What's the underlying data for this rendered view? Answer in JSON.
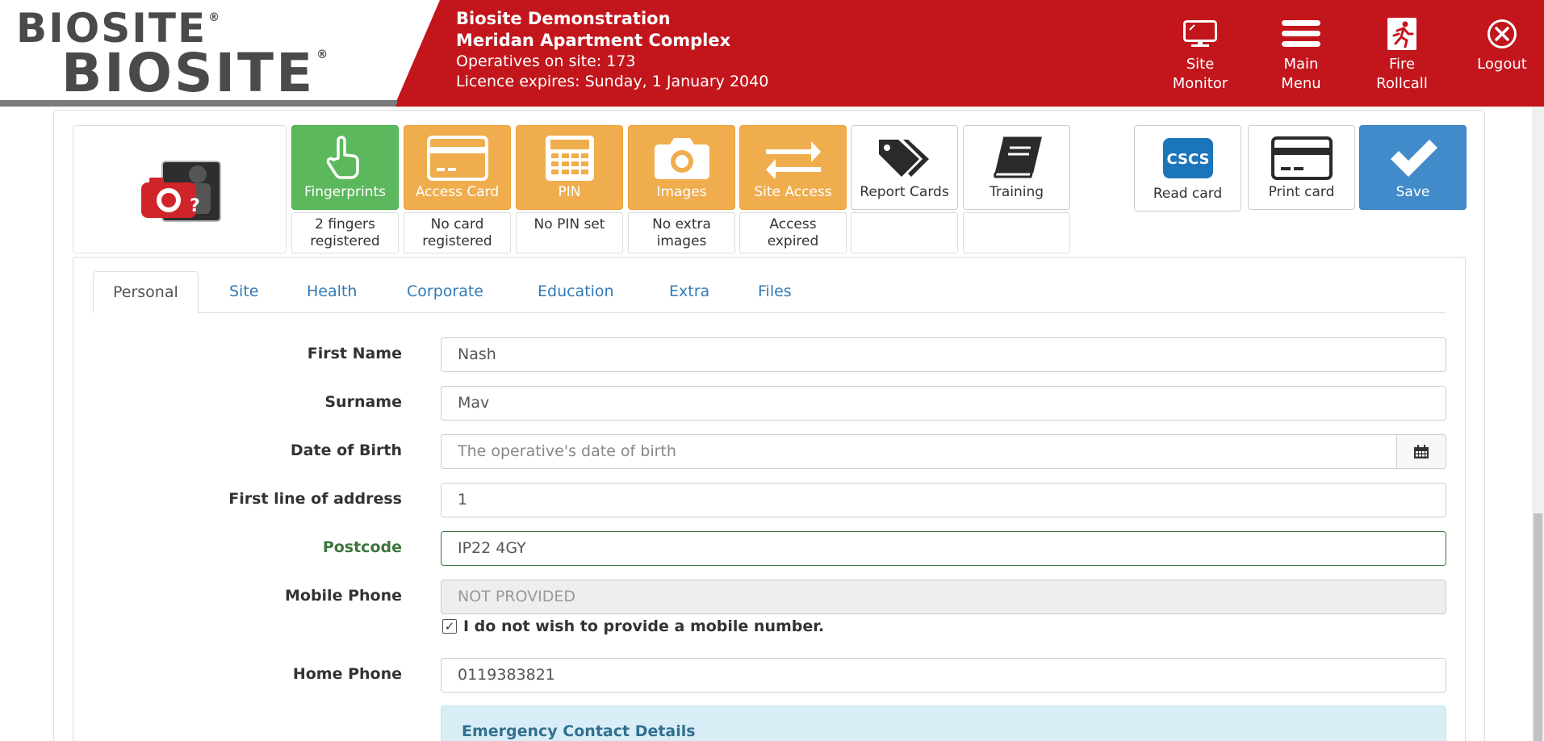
{
  "header": {
    "logo_line1": "BIOSITE",
    "logo_line2": "BIOSITE",
    "logo_reg": "®",
    "site_name": "Biosite Demonstration",
    "project_name": "Meridan Apartment Complex",
    "operatives": "Operatives on site: 173",
    "licence": "Licence expires: Sunday, 1 January 2040",
    "buttons": {
      "site_monitor": {
        "line1": "Site",
        "line2": "Monitor"
      },
      "main_menu": {
        "line1": "Main",
        "line2": "Menu"
      },
      "fire_rollcall": {
        "line1": "Fire",
        "line2": "Rollcall"
      },
      "logout": {
        "line1": "Logout"
      }
    }
  },
  "toolbar": {
    "fingerprints": {
      "label": "Fingerprints",
      "status_line1": "2 fingers",
      "status_line2": "registered"
    },
    "access_card": {
      "label": "Access Card",
      "status_line1": "No card",
      "status_line2": "registered"
    },
    "pin": {
      "label": "PIN",
      "status_line1": "No PIN set"
    },
    "images": {
      "label": "Images",
      "status_line1": "No extra",
      "status_line2": "images"
    },
    "site_access": {
      "label": "Site Access",
      "status_line1": "Access",
      "status_line2": "expired"
    },
    "report_cards": {
      "label": "Report Cards"
    },
    "training": {
      "label": "Training"
    },
    "read_card": {
      "label": "Read card",
      "badge": "CSCS"
    },
    "print_card": {
      "label": "Print card"
    },
    "save": {
      "label": "Save"
    }
  },
  "tabs": [
    "Personal",
    "Site",
    "Health",
    "Corporate",
    "Education",
    "Extra",
    "Files"
  ],
  "form": {
    "first_name": {
      "label": "First Name",
      "value": "Nash"
    },
    "surname": {
      "label": "Surname",
      "value": "Mav"
    },
    "dob": {
      "label": "Date of Birth",
      "placeholder": "The operative's date of birth"
    },
    "address": {
      "label": "First line of address",
      "value": "1"
    },
    "postcode": {
      "label": "Postcode",
      "value": "IP22 4GY"
    },
    "mobile": {
      "label": "Mobile Phone",
      "value": "NOT PROVIDED"
    },
    "no_mobile": {
      "label": "I do not wish to provide a mobile number.",
      "checked": "✓"
    },
    "home_phone": {
      "label": "Home Phone",
      "value": "0119383821"
    },
    "emergency_title": "Emergency Contact Details"
  },
  "colors": {
    "header": "#c3151c",
    "green": "#5cb85c",
    "orange": "#f0ad4e",
    "blue": "#428bca"
  }
}
